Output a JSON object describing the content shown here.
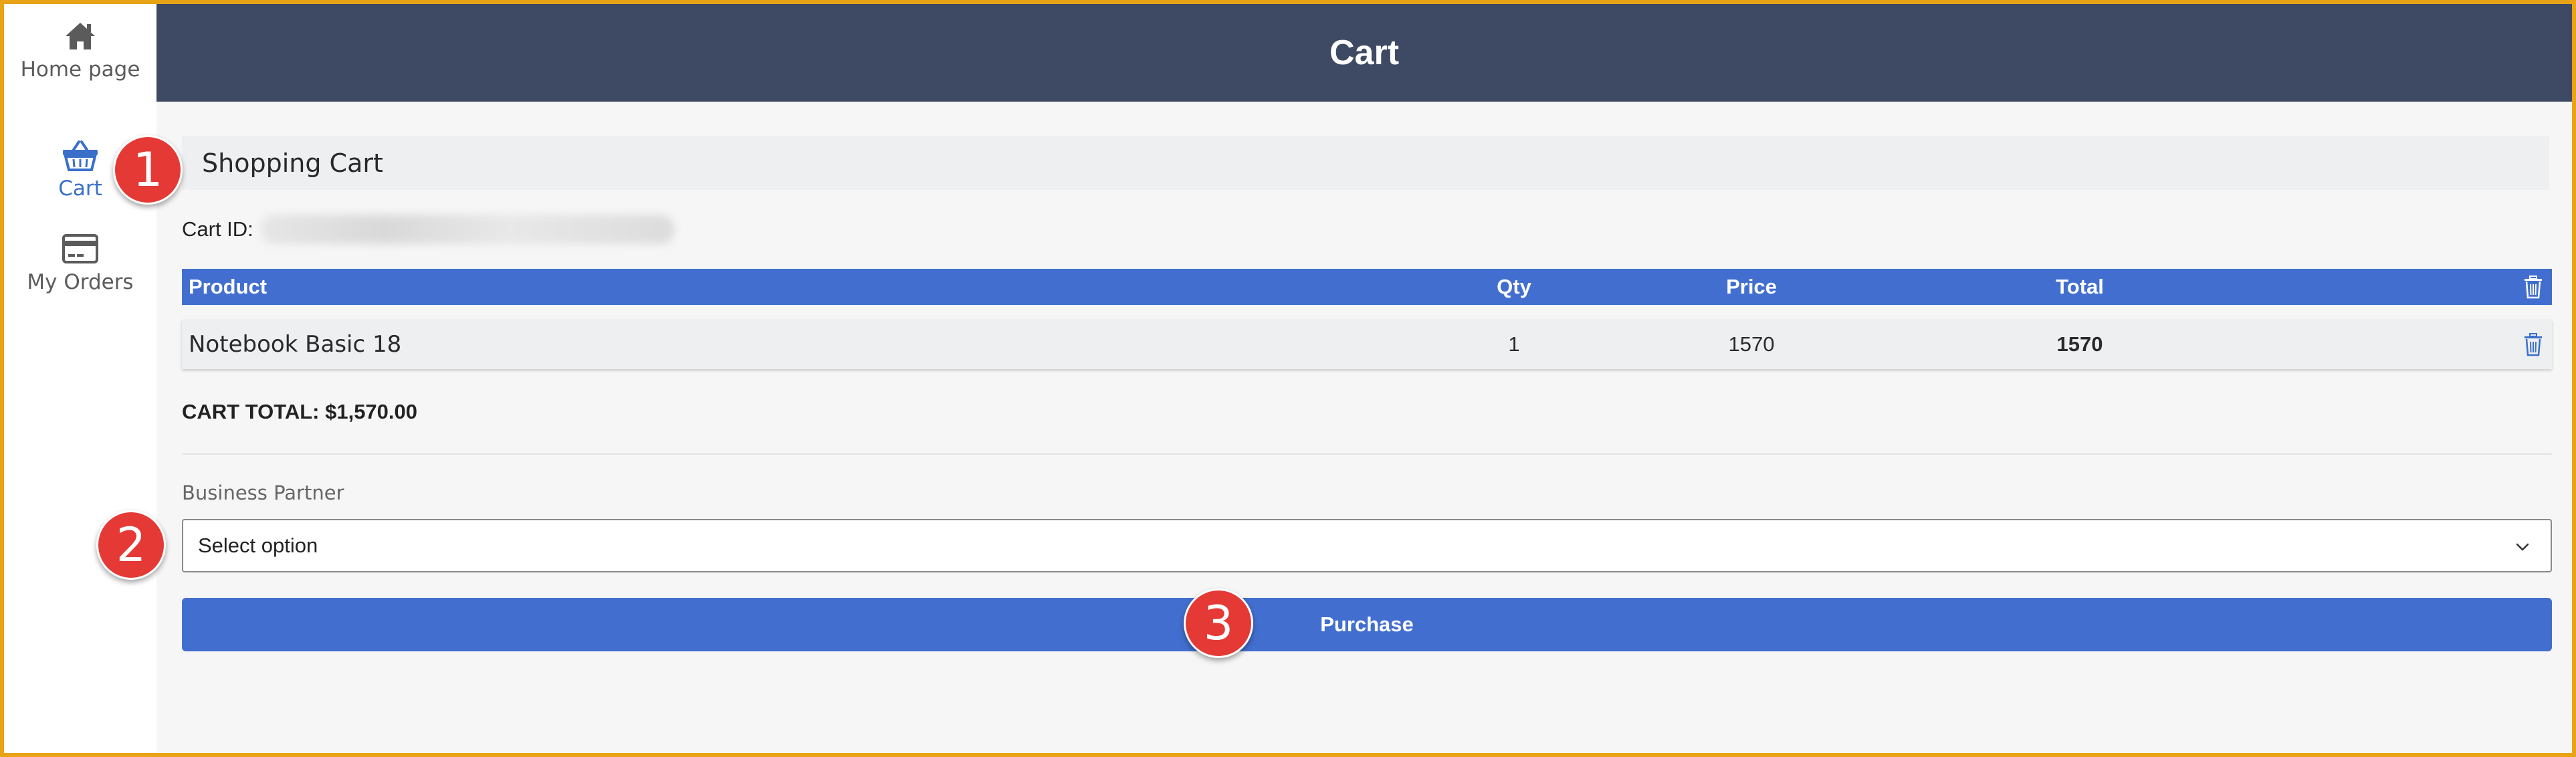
{
  "sidebar": {
    "items": [
      {
        "label": "Home page",
        "icon": "home-icon"
      },
      {
        "label": "Cart",
        "icon": "basket-icon"
      },
      {
        "label": "My Orders",
        "icon": "credit-card-icon"
      }
    ]
  },
  "header": {
    "title": "Cart"
  },
  "cart": {
    "panel_title": "Shopping Cart",
    "id_label": "Cart ID:",
    "table": {
      "columns": [
        "Product",
        "Qty",
        "Price",
        "Total"
      ],
      "rows": [
        {
          "product": "Notebook Basic 18",
          "qty": "1",
          "price": "1570",
          "total": "1570"
        }
      ]
    },
    "total_text": "CART TOTAL: $1,570.00"
  },
  "form": {
    "business_partner_label": "Business Partner",
    "select_value": "Select option",
    "purchase_label": "Purchase"
  },
  "markers": [
    "1",
    "2",
    "3"
  ],
  "colors": {
    "header_bg": "#3e4a63",
    "accent": "#426fcf",
    "active_nav": "#3a6fc9",
    "marker": "#e53935",
    "frame_border": "#e8a317"
  }
}
